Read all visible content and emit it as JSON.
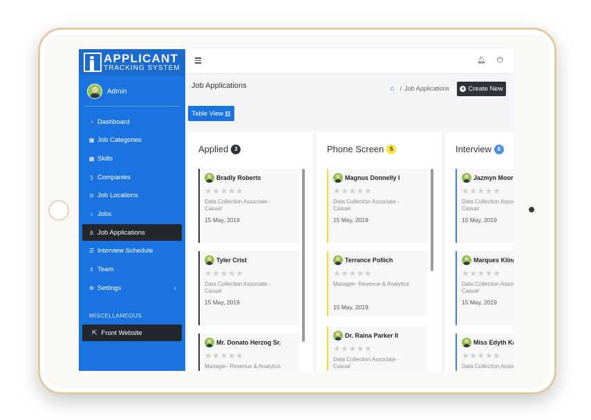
{
  "brand": {
    "title": "APPLICANT",
    "subtitle": "TRACKING SYSTEM"
  },
  "user": {
    "name": "Admin"
  },
  "sidebar": {
    "items": [
      {
        "label": "Dashboard",
        "icon": "dashboard-icon"
      },
      {
        "label": "Job Categories",
        "icon": "grid-icon"
      },
      {
        "label": "Skills",
        "icon": "grid-icon"
      },
      {
        "label": "Companies",
        "icon": "building-icon"
      },
      {
        "label": "Job Locations",
        "icon": "location-pin-icon"
      },
      {
        "label": "Jobs",
        "icon": "users-icon"
      },
      {
        "label": "Job Applications",
        "icon": "user-icon",
        "active": true
      },
      {
        "label": "Interview Schedule",
        "icon": "list-icon"
      },
      {
        "label": "Team",
        "icon": "team-icon"
      },
      {
        "label": "Settings",
        "icon": "gear-icon"
      }
    ],
    "misc_label": "MISCELLANEOUS",
    "front_website": "Front Website"
  },
  "header": {
    "title": "Job Applications",
    "breadcrumb": "Job Applications",
    "create_label": "Create New",
    "table_view_label": "Table View"
  },
  "colors": {
    "primary": "#1a73e0",
    "dark": "#2e3338",
    "yellow": "#ffd42a",
    "blue": "#2f80e6"
  },
  "columns": [
    {
      "title": "Applied",
      "count": "3",
      "cards": [
        {
          "name": "Bradly Roberts",
          "role": "Data Collection Associate - Casual",
          "date": "15 May, 2019"
        },
        {
          "name": "Tyler Crist",
          "role": "Data Collection Associate - Casual",
          "date": "15 May, 2019"
        },
        {
          "name": "Mr. Donato Herzog Sr.",
          "role": "Manager- Revenue & Analytics",
          "date": ""
        }
      ]
    },
    {
      "title": "Phone Screen",
      "count": "5",
      "cards": [
        {
          "name": "Magnus Donnelly I",
          "role": "Data Collection Associate - Casual",
          "date": "15 May, 2019"
        },
        {
          "name": "Terrance Pollich",
          "role": "Manager- Revenue & Analytics",
          "date": "15 May, 2019"
        },
        {
          "name": "Dr. Raina Parker II",
          "role": "Data Collection Associate - Casual",
          "date": ""
        }
      ]
    },
    {
      "title": "Interview",
      "count": "6",
      "cards": [
        {
          "name": "Jazmyn Moore",
          "role": "Data Collection Associate - Casual",
          "date": "15 May, 2019"
        },
        {
          "name": "Marques Kling",
          "role": "Data Collection Associate - Casual",
          "date": "15 May, 2019"
        },
        {
          "name": "Miss Edyth Kautzer",
          "role": "Data Collection Associate - Casual",
          "date": ""
        }
      ]
    }
  ]
}
